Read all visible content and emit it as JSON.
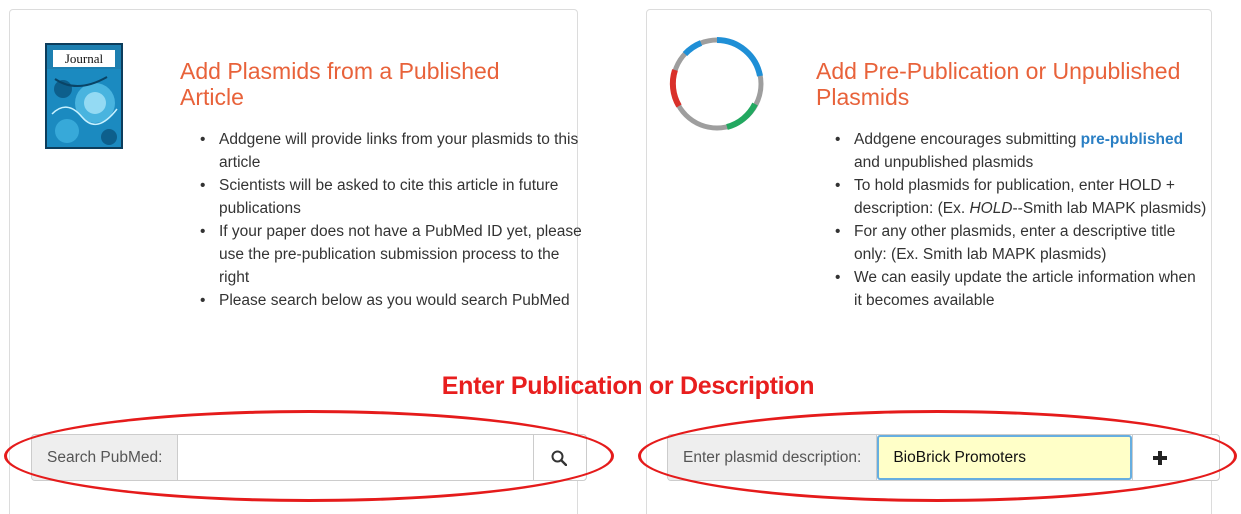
{
  "left_panel": {
    "journal_label": "Journal",
    "title": "Add Plasmids from a Published Article",
    "bullets": [
      "Addgene will provide links from your plasmids to this article",
      "Scientists will be asked to cite this article in future publications",
      "If your paper does not have a PubMed ID yet, please use the pre-publication submission process to the right",
      "Please search below as you would search PubMed"
    ],
    "search_addon": "Search PubMed:",
    "search_value": "",
    "search_icon": "search-icon"
  },
  "right_panel": {
    "title": "Add Pre-Publication or Unpublished Plasmids",
    "bullet1_pre": "Addgene encourages submitting ",
    "bullet1_link": "pre-published",
    "bullet1_post": " and unpublished plasmids",
    "bullet2_pre": "To hold plasmids for publication, enter HOLD + description: (Ex. ",
    "bullet2_em": "HOLD",
    "bullet2_post": "--Smith lab MAPK plasmids)",
    "bullet3": "For any other plasmids, enter a descriptive title only: (Ex. Smith lab MAPK plasmids)",
    "bullet4": "We can easily update the article information when it becomes available",
    "desc_addon": "Enter plasmid description:",
    "desc_value": "BioBrick Promoters",
    "add_icon": "plus-icon"
  },
  "annotation": "Enter Publication or Description",
  "colors": {
    "title": "#e8623a",
    "link": "#2a7fc4",
    "annotation": "#e81e1e",
    "highlight_field": "#ffffc8"
  }
}
